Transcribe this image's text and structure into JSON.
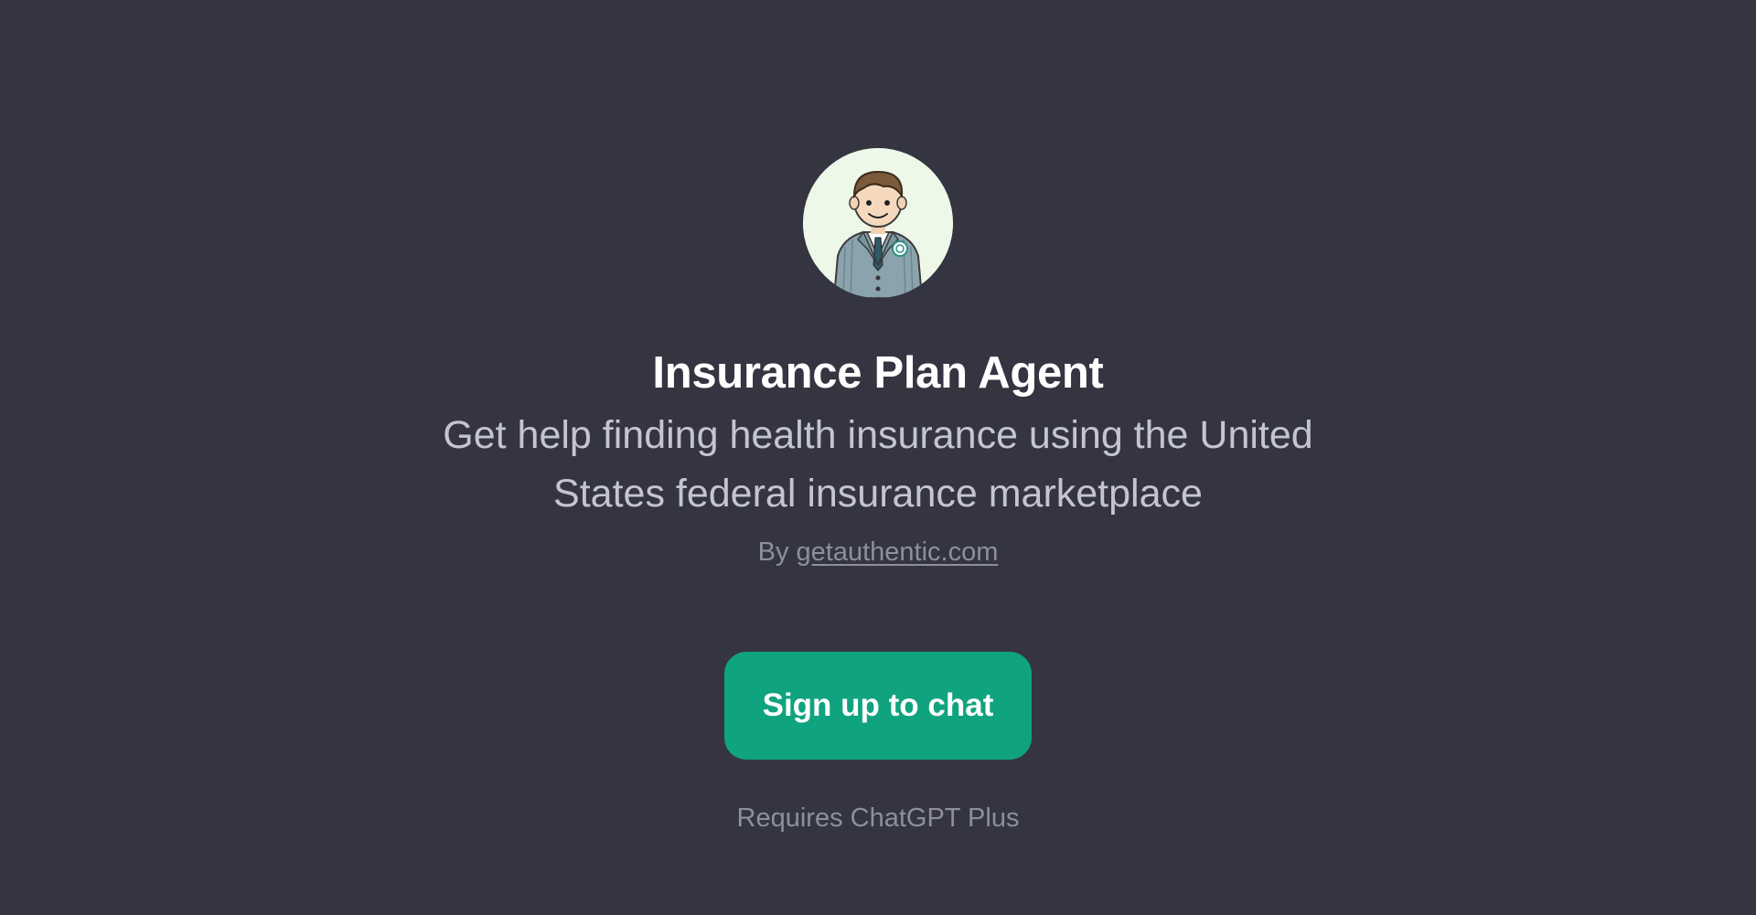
{
  "gpt": {
    "avatar_icon": "insurance-agent-avatar-icon",
    "title": "Insurance Plan Agent",
    "description": "Get help finding health insurance using the United States federal insurance marketplace",
    "byline_prefix": "By",
    "author_link": "getauthentic.com"
  },
  "cta": {
    "signup_label": "Sign up to chat",
    "requirement_note": "Requires ChatGPT Plus"
  },
  "colors": {
    "background": "#343541",
    "accent": "#10a37f",
    "title": "#ffffff",
    "description": "#c5c5d2",
    "muted": "#8e8ea0"
  }
}
